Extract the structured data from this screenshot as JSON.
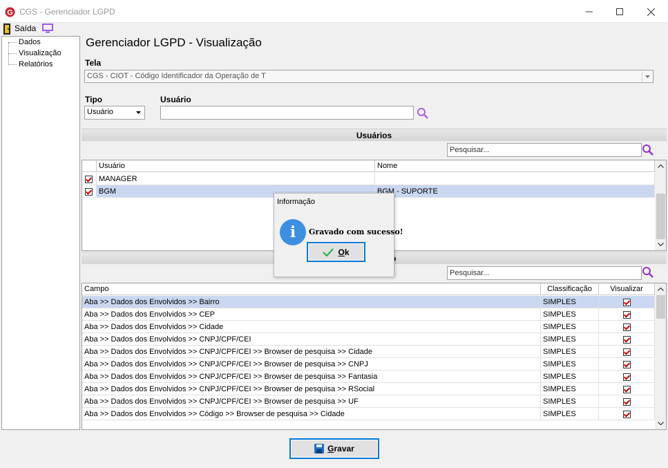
{
  "window": {
    "title": "CGS - Gerenciador LGPD",
    "logo_letter": "G"
  },
  "menu": {
    "exit_label": "Saída"
  },
  "sidebar": {
    "items": [
      {
        "label": "Dados"
      },
      {
        "label": "Visualização"
      },
      {
        "label": "Relatórios"
      }
    ]
  },
  "page": {
    "title": "Gerenciador LGPD - Visualização"
  },
  "form": {
    "tela_label": "Tela",
    "tela_value": "CGS - CIOT - Código Identificador da Operação de T",
    "tipo_label": "Tipo",
    "tipo_value": "Usuário",
    "usuario_label": "Usuário",
    "usuario_value": ""
  },
  "users_section": {
    "title": "Usuários",
    "search_placeholder": "Pesquisar...",
    "columns": [
      "Usuário",
      "Nome"
    ],
    "rows": [
      {
        "checked": true,
        "usuario": "MANAGER",
        "nome": "",
        "selected": false
      },
      {
        "checked": true,
        "usuario": "BGM",
        "nome": "BGM - SUPORTE",
        "selected": true
      }
    ]
  },
  "fields_section": {
    "title_suffix": "o",
    "search_placeholder": "Pesquisar...",
    "columns": [
      "Campo",
      "Classificação",
      "Visualizar"
    ],
    "rows": [
      {
        "campo": "Aba >> Dados dos Envolvidos >> Bairro",
        "classificacao": "SIMPLES",
        "visualizar": true,
        "selected": true
      },
      {
        "campo": "Aba >> Dados dos Envolvidos >> CEP",
        "classificacao": "SIMPLES",
        "visualizar": true,
        "selected": false
      },
      {
        "campo": "Aba >> Dados dos Envolvidos >> Cidade",
        "classificacao": "SIMPLES",
        "visualizar": true,
        "selected": false
      },
      {
        "campo": "Aba >> Dados dos Envolvidos >> CNPJ/CPF/CEI",
        "classificacao": "SIMPLES",
        "visualizar": true,
        "selected": false
      },
      {
        "campo": "Aba >> Dados dos Envolvidos >> CNPJ/CPF/CEI >> Browser de pesquisa >> Cidade",
        "classificacao": "SIMPLES",
        "visualizar": true,
        "selected": false
      },
      {
        "campo": "Aba >> Dados dos Envolvidos >> CNPJ/CPF/CEI >> Browser de pesquisa >> CNPJ",
        "classificacao": "SIMPLES",
        "visualizar": true,
        "selected": false
      },
      {
        "campo": "Aba >> Dados dos Envolvidos >> CNPJ/CPF/CEI >> Browser de pesquisa >> Fantasia",
        "classificacao": "SIMPLES",
        "visualizar": true,
        "selected": false
      },
      {
        "campo": "Aba >> Dados dos Envolvidos >> CNPJ/CPF/CEI >> Browser de pesquisa >> RSocial",
        "classificacao": "SIMPLES",
        "visualizar": true,
        "selected": false
      },
      {
        "campo": "Aba >> Dados dos Envolvidos >> CNPJ/CPF/CEI >> Browser de pesquisa >> UF",
        "classificacao": "SIMPLES",
        "visualizar": true,
        "selected": false
      },
      {
        "campo": "Aba >> Dados dos Envolvidos >> Código >> Browser de pesquisa >> Cidade",
        "classificacao": "SIMPLES",
        "visualizar": true,
        "selected": false
      }
    ]
  },
  "footer": {
    "save_label_accel": "G",
    "save_label_rest": "ravar"
  },
  "dialog": {
    "title": "Informação",
    "icon_letter": "i",
    "message": "Gravado com sucesso!",
    "ok_accel": "O",
    "ok_rest": "k"
  },
  "colors": {
    "selection": "#c9d7f0",
    "check_red": "#d00000",
    "info_blue": "#3d8fe0",
    "search_purple": "#9b30c8",
    "focus_blue": "#0078d7"
  }
}
